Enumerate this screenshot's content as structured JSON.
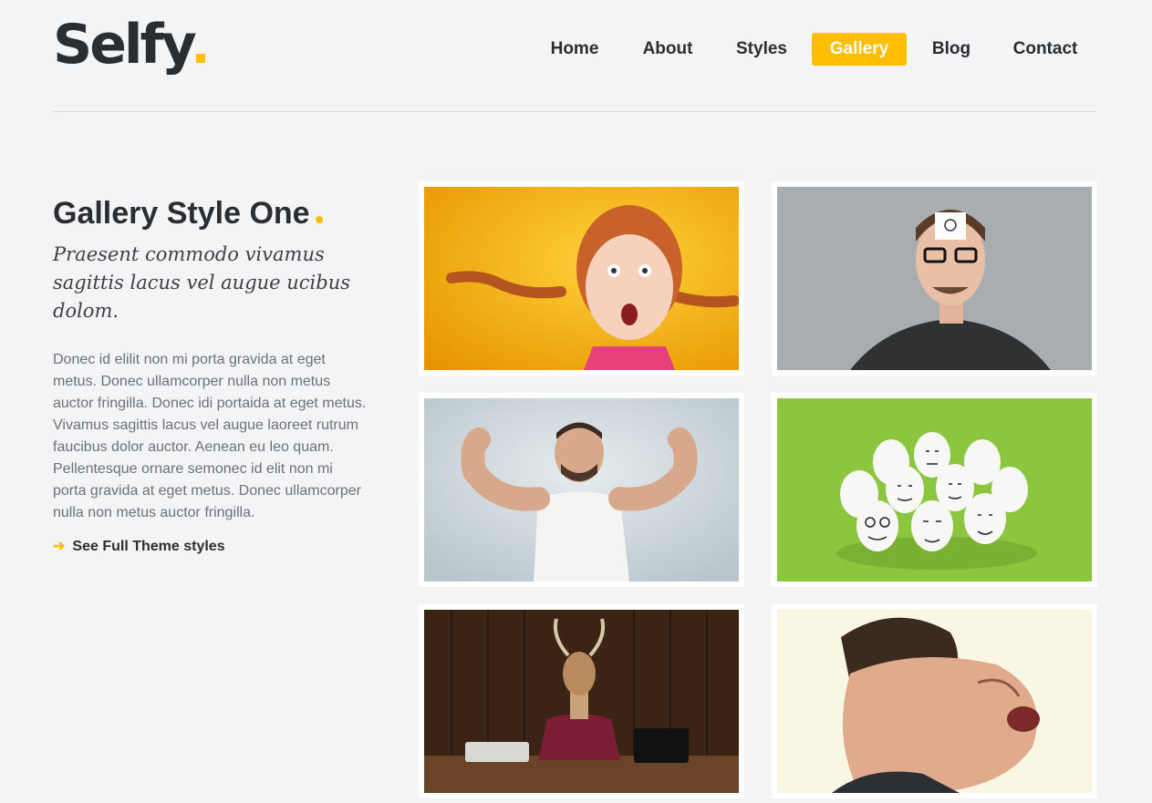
{
  "brand": {
    "name": "Selfy",
    "accent": "#ffbe00",
    "text_color": "#2b2e31",
    "background": "#f3f4f6"
  },
  "nav": {
    "active": "Gallery",
    "items": [
      {
        "label": "Home"
      },
      {
        "label": "About"
      },
      {
        "label": "Styles"
      },
      {
        "label": "Gallery"
      },
      {
        "label": "Blog"
      },
      {
        "label": "Contact"
      }
    ]
  },
  "intro": {
    "title": "Gallery Style One",
    "subtitle": "Praesent commodo vivamus sagittis lacus vel augue ucibus dolom.",
    "body": "Donec id elilit non mi porta gravida at eget metus. Donec ullamcorper nulla non metus auctor fringilla. Donec idi portaida at eget metus. Vivamus sagittis lacus vel augue laoreet rutrum faucibus dolor auctor. Aenean eu leo quam. Pellentesque ornare semonec id elit non mi porta gravida at eget metus. Donec ullamcorper nulla non metus auctor fringilla.",
    "link_label": "See Full Theme styles",
    "link_icon": "arrow-right-icon"
  },
  "gallery": [
    {
      "subject": "girl-with-braids",
      "background": "#f7b500"
    },
    {
      "subject": "man-with-note",
      "background": "#a8adb0"
    },
    {
      "subject": "strongman",
      "background": "#c7d2d8"
    },
    {
      "subject": "eggs-with-faces",
      "background": "#8cc63f"
    },
    {
      "subject": "deer-boss",
      "background": "#3b2416"
    },
    {
      "subject": "squished-face",
      "background": "#faf6e4"
    }
  ]
}
